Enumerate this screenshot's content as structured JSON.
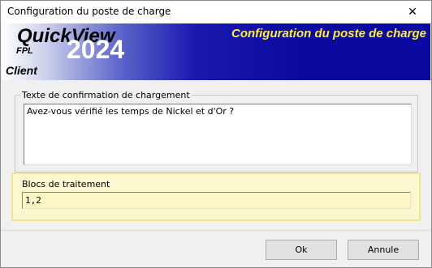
{
  "window": {
    "title": "Configuration du poste de charge",
    "close_glyph": "✕"
  },
  "banner": {
    "logo_name": "QuickView",
    "logo_sub": "FPL",
    "logo_year": "2024",
    "logo_edition": "Client",
    "heading": "Configuration du poste de charge",
    "heading_color": "#ffee33"
  },
  "confirmation": {
    "legend": "Texte de confirmation de chargement",
    "value": "Avez-vous vérifié les temps de Nickel et d'Or ?"
  },
  "blocs": {
    "label": "Blocs de traitement",
    "value": "1,2"
  },
  "buttons": {
    "ok_label": "Ok",
    "cancel_label": "Annule"
  }
}
